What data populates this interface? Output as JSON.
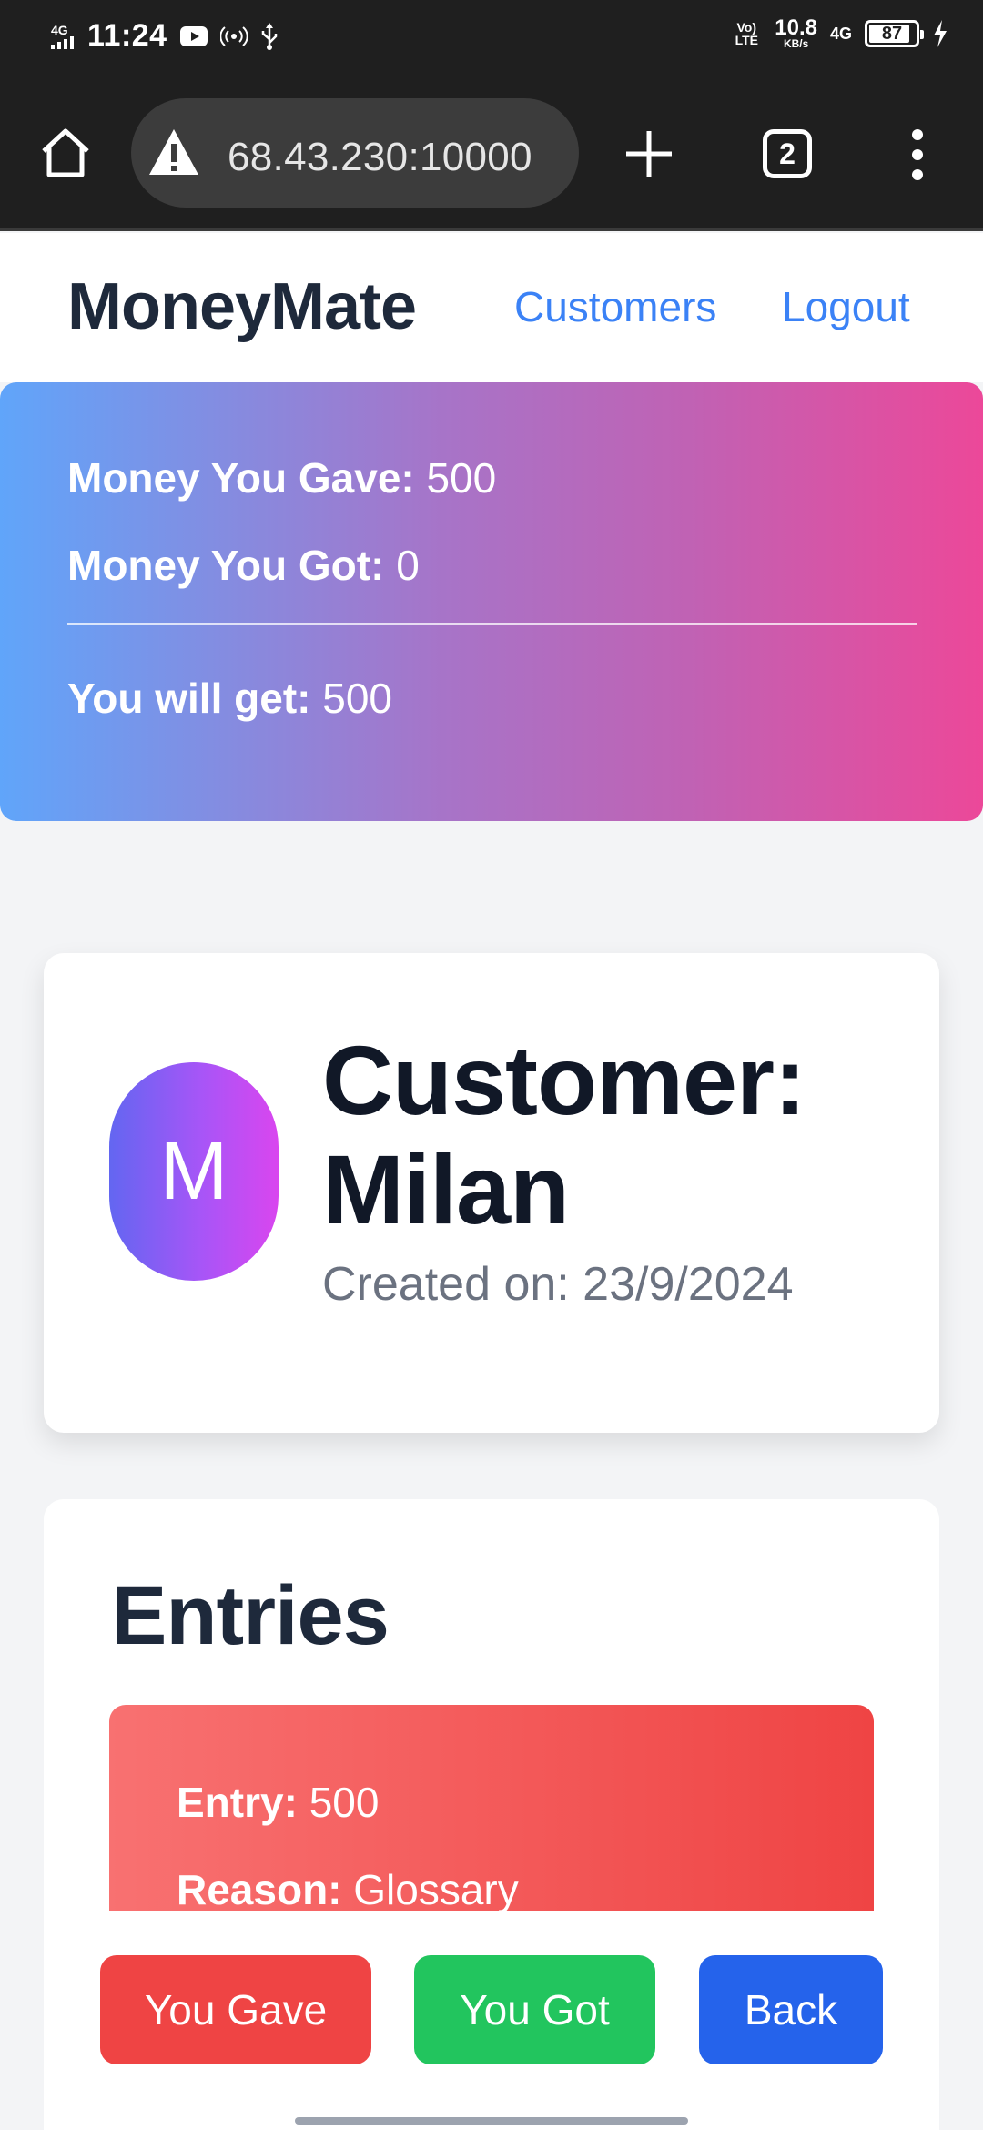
{
  "status_bar": {
    "network_left": "4G",
    "time": "11:24",
    "volte": "Vo) LTE",
    "speed_value": "10.8",
    "speed_unit": "KB/s",
    "network_right": "4G",
    "battery": "87"
  },
  "browser": {
    "url": "68.43.230:10000",
    "tab_count": "2"
  },
  "header": {
    "brand": "MoneyMate",
    "nav": [
      "Customers",
      "Logout"
    ]
  },
  "summary": {
    "gave_label": "Money You Gave:",
    "gave_value": "500",
    "got_label": "Money You Got:",
    "got_value": "0",
    "will_label": "You will get:",
    "will_value": "500"
  },
  "customer": {
    "avatar_initial": "M",
    "title": "Customer: Milan",
    "created": "Created on: 23/9/2024"
  },
  "entries": {
    "title": "Entries",
    "items": [
      {
        "amount_label": "Entry:",
        "amount": "500",
        "reason_label": "Reason:",
        "reason": "Glossary"
      }
    ]
  },
  "actions": {
    "gave": "You Gave",
    "got": "You Got",
    "back": "Back"
  },
  "colors": {
    "accent": "#3b82f6",
    "gave": "#ef4444",
    "got": "#22c55e",
    "back": "#2563eb"
  }
}
